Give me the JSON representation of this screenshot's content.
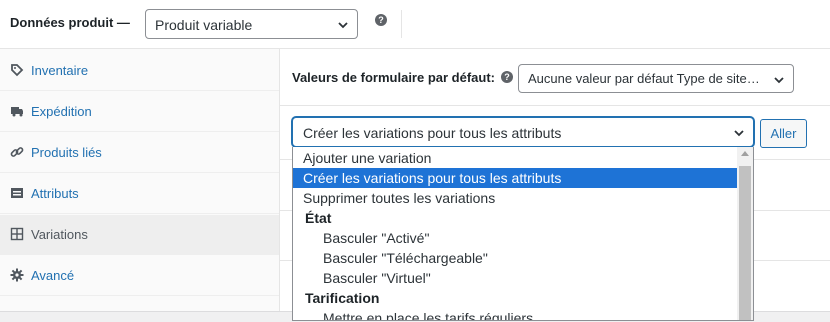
{
  "header": {
    "title": "Données produit —",
    "product_type": "Produit variable"
  },
  "sidebar": {
    "items": [
      {
        "label": "Inventaire",
        "icon": "tag-icon",
        "active": false
      },
      {
        "label": "Expédition",
        "icon": "truck-icon",
        "active": false
      },
      {
        "label": "Produits liés",
        "icon": "link-icon",
        "active": false
      },
      {
        "label": "Attributs",
        "icon": "list-card-icon",
        "active": false
      },
      {
        "label": "Variations",
        "icon": "grid-icon",
        "active": true
      },
      {
        "label": "Avancé",
        "icon": "gear-icon",
        "active": false
      }
    ]
  },
  "main": {
    "default_values_label": "Valeurs de formulaire par défaut:",
    "default_values_select": "Aucune valeur par défaut Type de site…",
    "bulk_action_value": "Créer les variations pour tous les attributs",
    "go_button": "Aller"
  },
  "dropdown": {
    "options": [
      {
        "label": "Ajouter une variation",
        "kind": "option"
      },
      {
        "label": "Créer les variations pour tous les attributs",
        "kind": "selected"
      },
      {
        "label": "Supprimer toutes les variations",
        "kind": "option"
      },
      {
        "label": "État",
        "kind": "group"
      },
      {
        "label": "Basculer \"Activé\"",
        "kind": "child"
      },
      {
        "label": "Basculer \"Téléchargeable\"",
        "kind": "child"
      },
      {
        "label": "Basculer \"Virtuel\"",
        "kind": "child"
      },
      {
        "label": "Tarification",
        "kind": "group"
      },
      {
        "label": "Mettre en place les tarifs réguliers",
        "kind": "child"
      }
    ]
  },
  "colors": {
    "link": "#2271b1",
    "selection": "#1e73d6"
  }
}
